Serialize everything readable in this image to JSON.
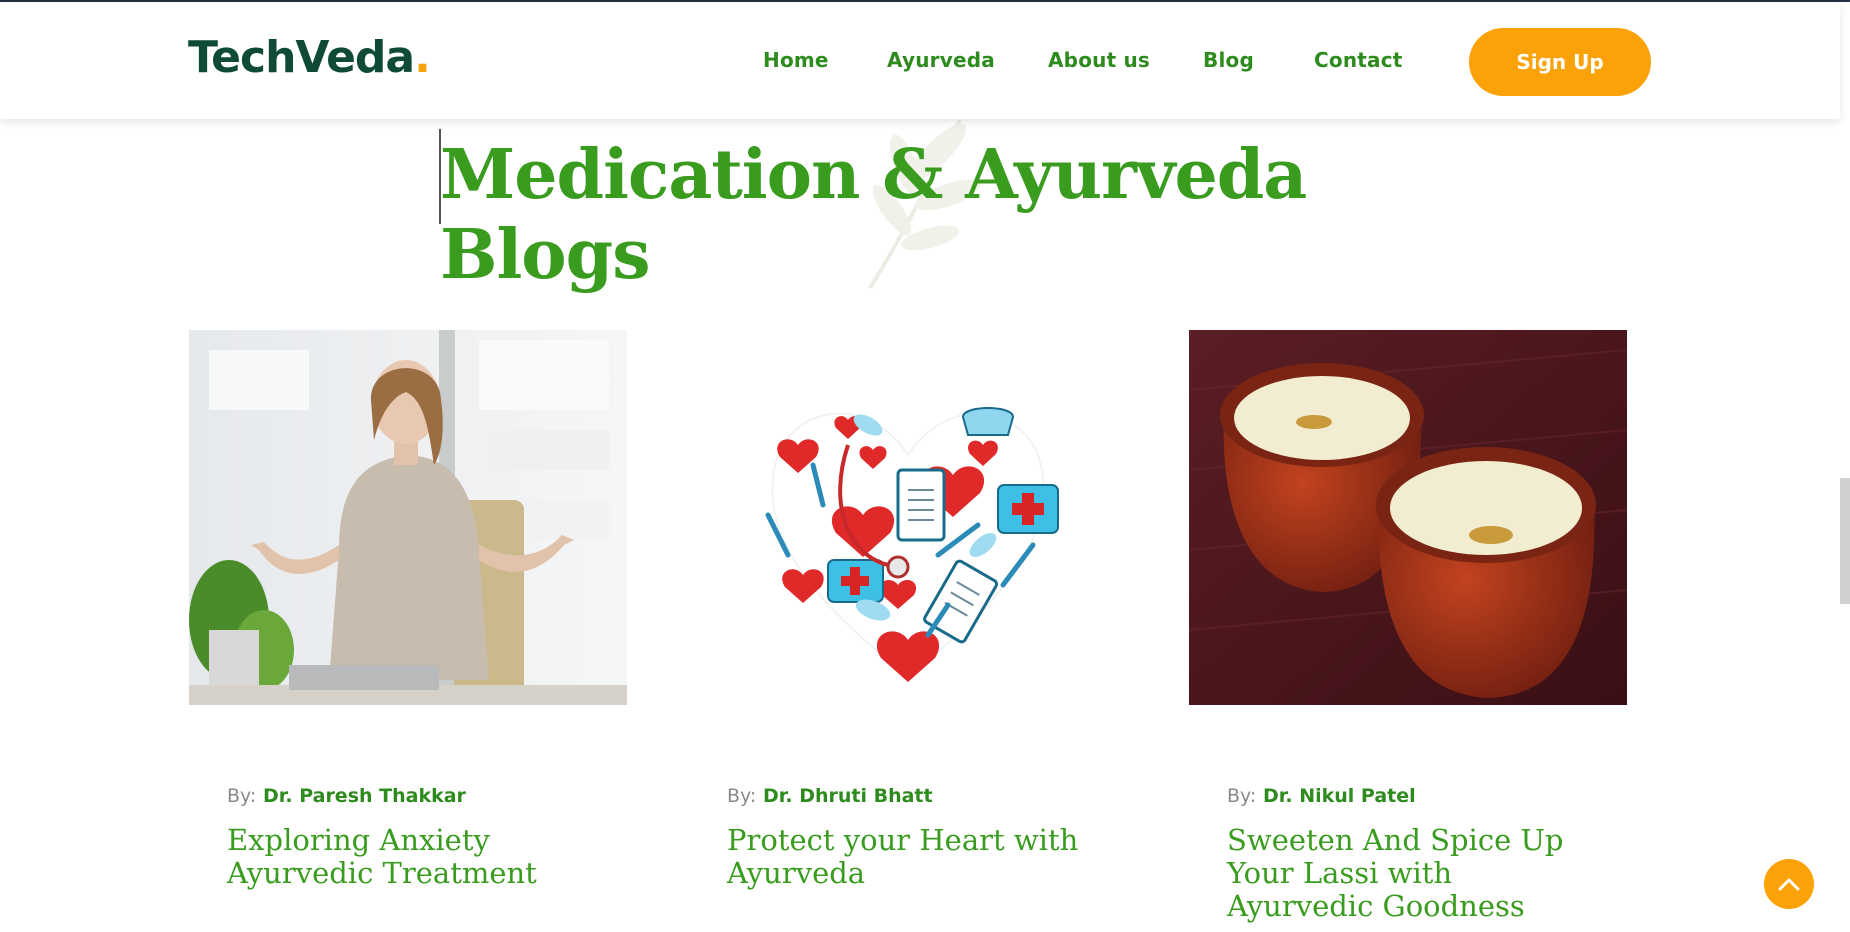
{
  "header": {
    "logo_text": "TechVeda",
    "logo_dot": ".",
    "nav": [
      {
        "label": "Home"
      },
      {
        "label": "Ayurveda"
      },
      {
        "label": "About us"
      },
      {
        "label": "Blog"
      },
      {
        "label": "Contact"
      }
    ],
    "signup_label": "Sign Up"
  },
  "section": {
    "title": "Medication & Ayurveda Blogs"
  },
  "posts": [
    {
      "by_label": "By:",
      "author": "Dr. Paresh Thakkar",
      "title": "Exploring Anxiety Ayurvedic Treatment",
      "image": "woman-meditating-photo"
    },
    {
      "by_label": "By:",
      "author": "Dr. Dhruti Bhatt",
      "title": "Protect your Heart with Ayurveda",
      "image": "heart-medical-icons-illustration"
    },
    {
      "by_label": "By:",
      "author": "Dr. Nikul Patel",
      "title": "Sweeten And Spice Up Your Lassi with Ayurvedic Goodness",
      "image": "lassi-clay-cups-photo"
    }
  ],
  "colors": {
    "brand_dark": "#0e4a36",
    "accent": "#fba209",
    "green": "#3a9c1f",
    "nav_green": "#2e8b1e"
  },
  "icons": {
    "back_to_top": "chevron-up-icon",
    "watermark": "leaf-icon"
  }
}
